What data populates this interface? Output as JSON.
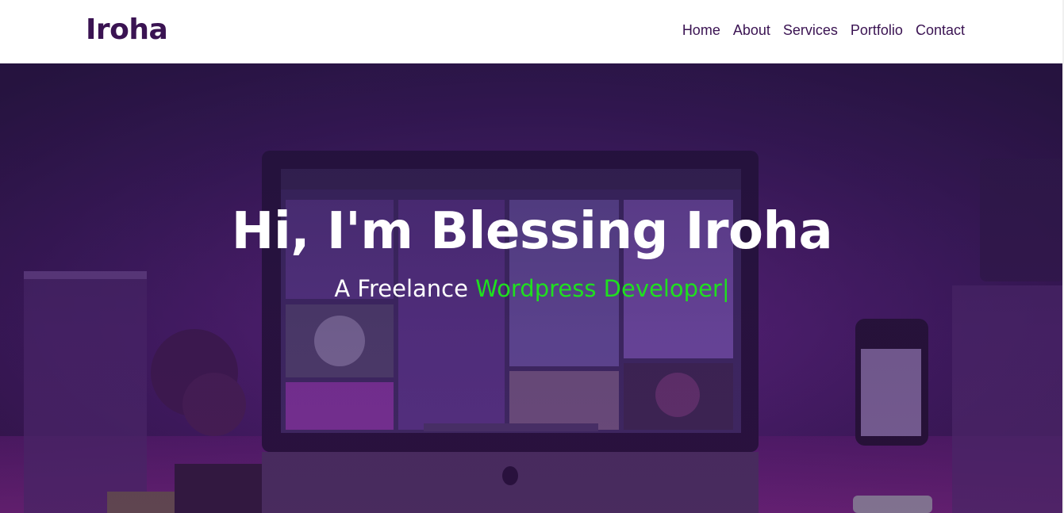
{
  "header": {
    "logo": "Iroha",
    "nav": [
      {
        "label": "Home"
      },
      {
        "label": "About"
      },
      {
        "label": "Services"
      },
      {
        "label": "Portfolio"
      },
      {
        "label": "Contact"
      }
    ]
  },
  "hero": {
    "title": "Hi, I'm Blessing Iroha",
    "subtitle_prefix": "A Freelance ",
    "subtitle_typed": "Wordpress Developer",
    "cursor": "|"
  },
  "colors": {
    "brand": "#3a1352",
    "accent_typed": "#1fe01f",
    "header_bg": "#ffffff",
    "hero_tint": "#2a1440"
  }
}
